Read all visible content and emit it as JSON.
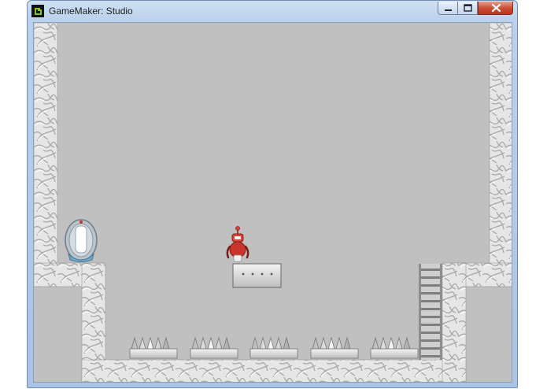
{
  "window": {
    "title": "GameMaker: Studio",
    "app_icon": "gamemaker-icon",
    "controls": [
      "minimize-icon",
      "maximize-icon",
      "close-icon"
    ]
  },
  "game": {
    "background_color": "#c0c0c0",
    "wall_color": "#e6e6e6",
    "player": "red robot",
    "player_color": "#c9342b",
    "objects": [
      "exit-portal",
      "player-robot",
      "riveted-metal-platform",
      "ladder",
      "spike-trap"
    ],
    "spike_trap_count": 5,
    "spikes_per_trap": 5
  }
}
